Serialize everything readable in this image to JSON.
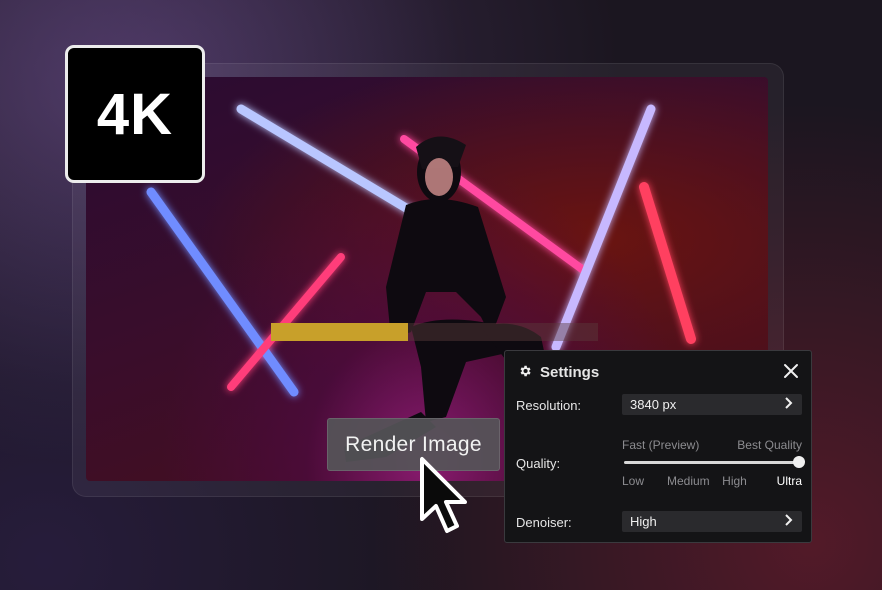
{
  "badge": {
    "label": "4K"
  },
  "render": {
    "button_label": "Render Image",
    "progress_fraction": 0.42
  },
  "settings": {
    "title": "Settings",
    "resolution": {
      "label": "Resolution:",
      "value": "3840 px"
    },
    "quality": {
      "label": "Quality:",
      "scale_low": "Fast (Preview)",
      "scale_high": "Best Quality",
      "levels": [
        "Low",
        "Medium",
        "High",
        "Ultra"
      ],
      "selected": "Ultra",
      "level_fraction": 1.0
    },
    "denoiser": {
      "label": "Denoiser:",
      "value": "High"
    }
  },
  "icons": {
    "settings": "gear-icon",
    "close": "close-icon",
    "chevron": "chevron-right-icon",
    "cursor": "mouse-pointer-icon"
  },
  "colors": {
    "progress": "#c8a02a",
    "panel_bg": "#141416",
    "badge_bg": "#000000"
  }
}
